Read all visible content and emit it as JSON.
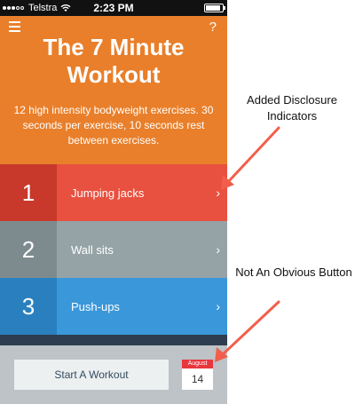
{
  "status_bar": {
    "carrier": "Telstra",
    "time": "2:23 PM",
    "battery_level": 0.9
  },
  "header": {
    "menu_icon": "hamburger-menu-icon",
    "help_label": "?",
    "title": "The 7 Minute Workout",
    "description": "12 high intensity bodyweight exercises. 30 seconds per exercise, 10 seconds rest between exercises."
  },
  "exercises": [
    {
      "number": "1",
      "name": "Jumping jacks",
      "chevron": "›",
      "color": "#e8503f",
      "accent": "#c8392b"
    },
    {
      "number": "2",
      "name": "Wall sits",
      "chevron": "›",
      "color": "#96a3a6",
      "accent": "#7e8b8e"
    },
    {
      "number": "3",
      "name": "Push-ups",
      "chevron": "›",
      "color": "#3a97da",
      "accent": "#2a80bf"
    }
  ],
  "footer": {
    "start_button": "Start A Workout",
    "calendar": {
      "month": "August",
      "day": "14"
    }
  },
  "annotations": {
    "disclosure": "Added Disclosure Indicators",
    "button": "Not An Obvious Button",
    "arrow_color": "#f25e4b"
  },
  "colors": {
    "orange": "#e97f2a",
    "footer_gray": "#bdc3c7"
  }
}
